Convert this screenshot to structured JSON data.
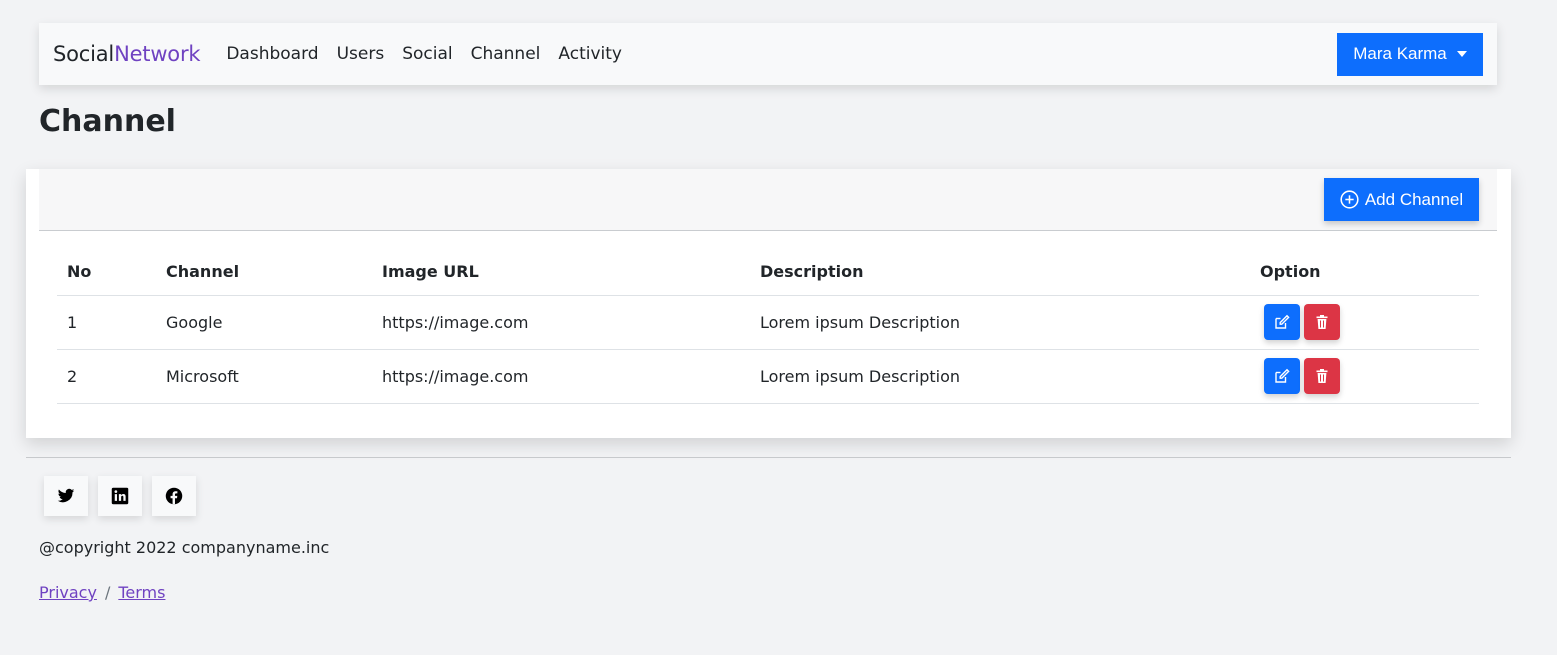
{
  "navbar": {
    "brand_part1": "Social",
    "brand_part2": "Network",
    "links": [
      "Dashboard",
      "Users",
      "Social",
      "Channel",
      "Activity"
    ],
    "user_name": "Mara Karma"
  },
  "page": {
    "title": "Channel"
  },
  "toolbar": {
    "add_label": "Add Channel"
  },
  "table": {
    "headers": [
      "No",
      "Channel",
      "Image URL",
      "Description",
      "Option"
    ],
    "rows": [
      {
        "no": "1",
        "channel": "Google",
        "image_url": "https://image.com",
        "description": "Lorem ipsum Description"
      },
      {
        "no": "2",
        "channel": "Microsoft",
        "image_url": "https://image.com",
        "description": "Lorem ipsum Description"
      }
    ]
  },
  "footer": {
    "copyright": "@copyright 2022 companyname.inc",
    "privacy": "Privacy",
    "separator": "/",
    "terms": "Terms",
    "social_icons": [
      "twitter-icon",
      "linkedin-icon",
      "facebook-icon"
    ]
  },
  "colors": {
    "primary": "#0d6efd",
    "danger": "#dc3545",
    "accent": "#6f42c1"
  }
}
